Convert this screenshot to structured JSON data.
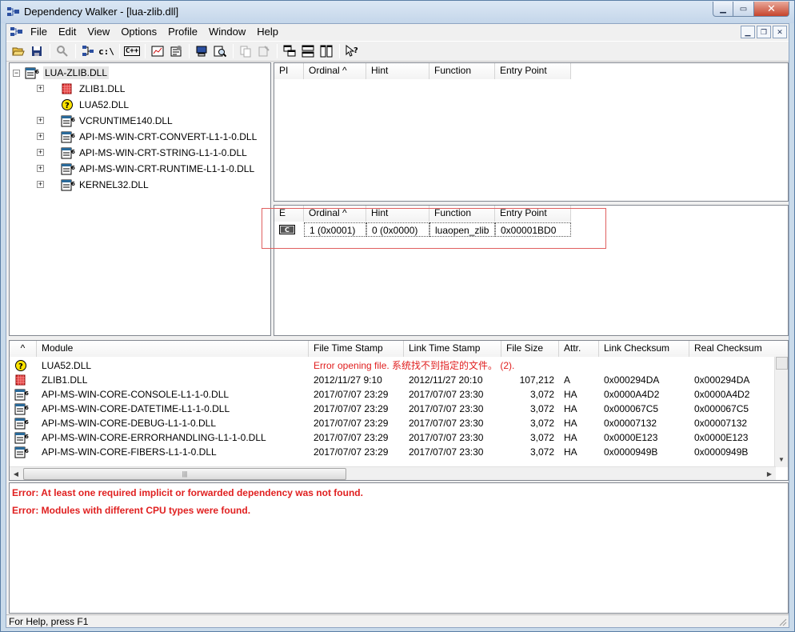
{
  "window": {
    "title": "Dependency Walker - [lua-zlib.dll]"
  },
  "menu": [
    "File",
    "Edit",
    "View",
    "Options",
    "Profile",
    "Window",
    "Help"
  ],
  "toolbar": {
    "copy_path_label": "c:\\",
    "cpp_label": "C++"
  },
  "tree": {
    "root": "LUA-ZLIB.DLL",
    "children": [
      {
        "label": "ZLIB1.DLL",
        "icon": "module-red-icon",
        "expandable": true
      },
      {
        "label": "LUA52.DLL",
        "icon": "missing-module-icon",
        "expandable": false
      },
      {
        "label": "VCRUNTIME140.DLL",
        "icon": "module-icon",
        "expandable": true
      },
      {
        "label": "API-MS-WIN-CRT-CONVERT-L1-1-0.DLL",
        "icon": "module-icon",
        "expandable": true
      },
      {
        "label": "API-MS-WIN-CRT-STRING-L1-1-0.DLL",
        "icon": "module-icon",
        "expandable": true
      },
      {
        "label": "API-MS-WIN-CRT-RUNTIME-L1-1-0.DLL",
        "icon": "module-icon",
        "expandable": true
      },
      {
        "label": "KERNEL32.DLL",
        "icon": "module-icon",
        "expandable": true
      }
    ]
  },
  "imports": {
    "headers": [
      "PI",
      "Ordinal ^",
      "Hint",
      "Function",
      "Entry Point"
    ]
  },
  "exports": {
    "headers": [
      "E",
      "Ordinal ^",
      "Hint",
      "Function",
      "Entry Point"
    ],
    "rows": [
      {
        "ordinal": "1 (0x0001)",
        "hint": "0 (0x0000)",
        "function": "luaopen_zlib",
        "entry": "0x00001BD0"
      }
    ]
  },
  "modules": {
    "headers": [
      "^",
      "Module",
      "File Time Stamp",
      "Link Time Stamp",
      "File Size",
      "Attr.",
      "Link Checksum",
      "Real Checksum"
    ],
    "rows": [
      {
        "icon": "missing-module-icon",
        "module": "LUA52.DLL",
        "error": "Error opening file. 系统找不到指定的文件。 (2)."
      },
      {
        "icon": "module-red-icon",
        "module": "ZLIB1.DLL",
        "fts": "2012/11/27   9:10",
        "lts": "2012/11/27 20:10",
        "size": "107,212",
        "attr": "A",
        "link": "0x000294DA",
        "real": "0x000294DA"
      },
      {
        "icon": "module-icon",
        "module": "API-MS-WIN-CORE-CONSOLE-L1-1-0.DLL",
        "fts": "2017/07/07 23:29",
        "lts": "2017/07/07 23:30",
        "size": "3,072",
        "attr": "HA",
        "link": "0x0000A4D2",
        "real": "0x0000A4D2"
      },
      {
        "icon": "module-icon",
        "module": "API-MS-WIN-CORE-DATETIME-L1-1-0.DLL",
        "fts": "2017/07/07 23:29",
        "lts": "2017/07/07 23:30",
        "size": "3,072",
        "attr": "HA",
        "link": "0x000067C5",
        "real": "0x000067C5"
      },
      {
        "icon": "module-icon",
        "module": "API-MS-WIN-CORE-DEBUG-L1-1-0.DLL",
        "fts": "2017/07/07 23:29",
        "lts": "2017/07/07 23:30",
        "size": "3,072",
        "attr": "HA",
        "link": "0x00007132",
        "real": "0x00007132"
      },
      {
        "icon": "module-icon",
        "module": "API-MS-WIN-CORE-ERRORHANDLING-L1-1-0.DLL",
        "fts": "2017/07/07 23:29",
        "lts": "2017/07/07 23:30",
        "size": "3,072",
        "attr": "HA",
        "link": "0x0000E123",
        "real": "0x0000E123"
      },
      {
        "icon": "module-icon",
        "module": "API-MS-WIN-CORE-FIBERS-L1-1-0.DLL",
        "fts": "2017/07/07 23:29",
        "lts": "2017/07/07 23:30",
        "size": "3,072",
        "attr": "HA",
        "link": "0x0000949B",
        "real": "0x0000949B"
      }
    ]
  },
  "log": [
    "Error: At least one required implicit or forwarded dependency was not found.",
    "Error: Modules with different CPU types were found."
  ],
  "status": "For Help, press F1",
  "colors": {
    "error": "#e02020",
    "title_bar": "#c9daea",
    "highlight_box": "#e06060"
  }
}
